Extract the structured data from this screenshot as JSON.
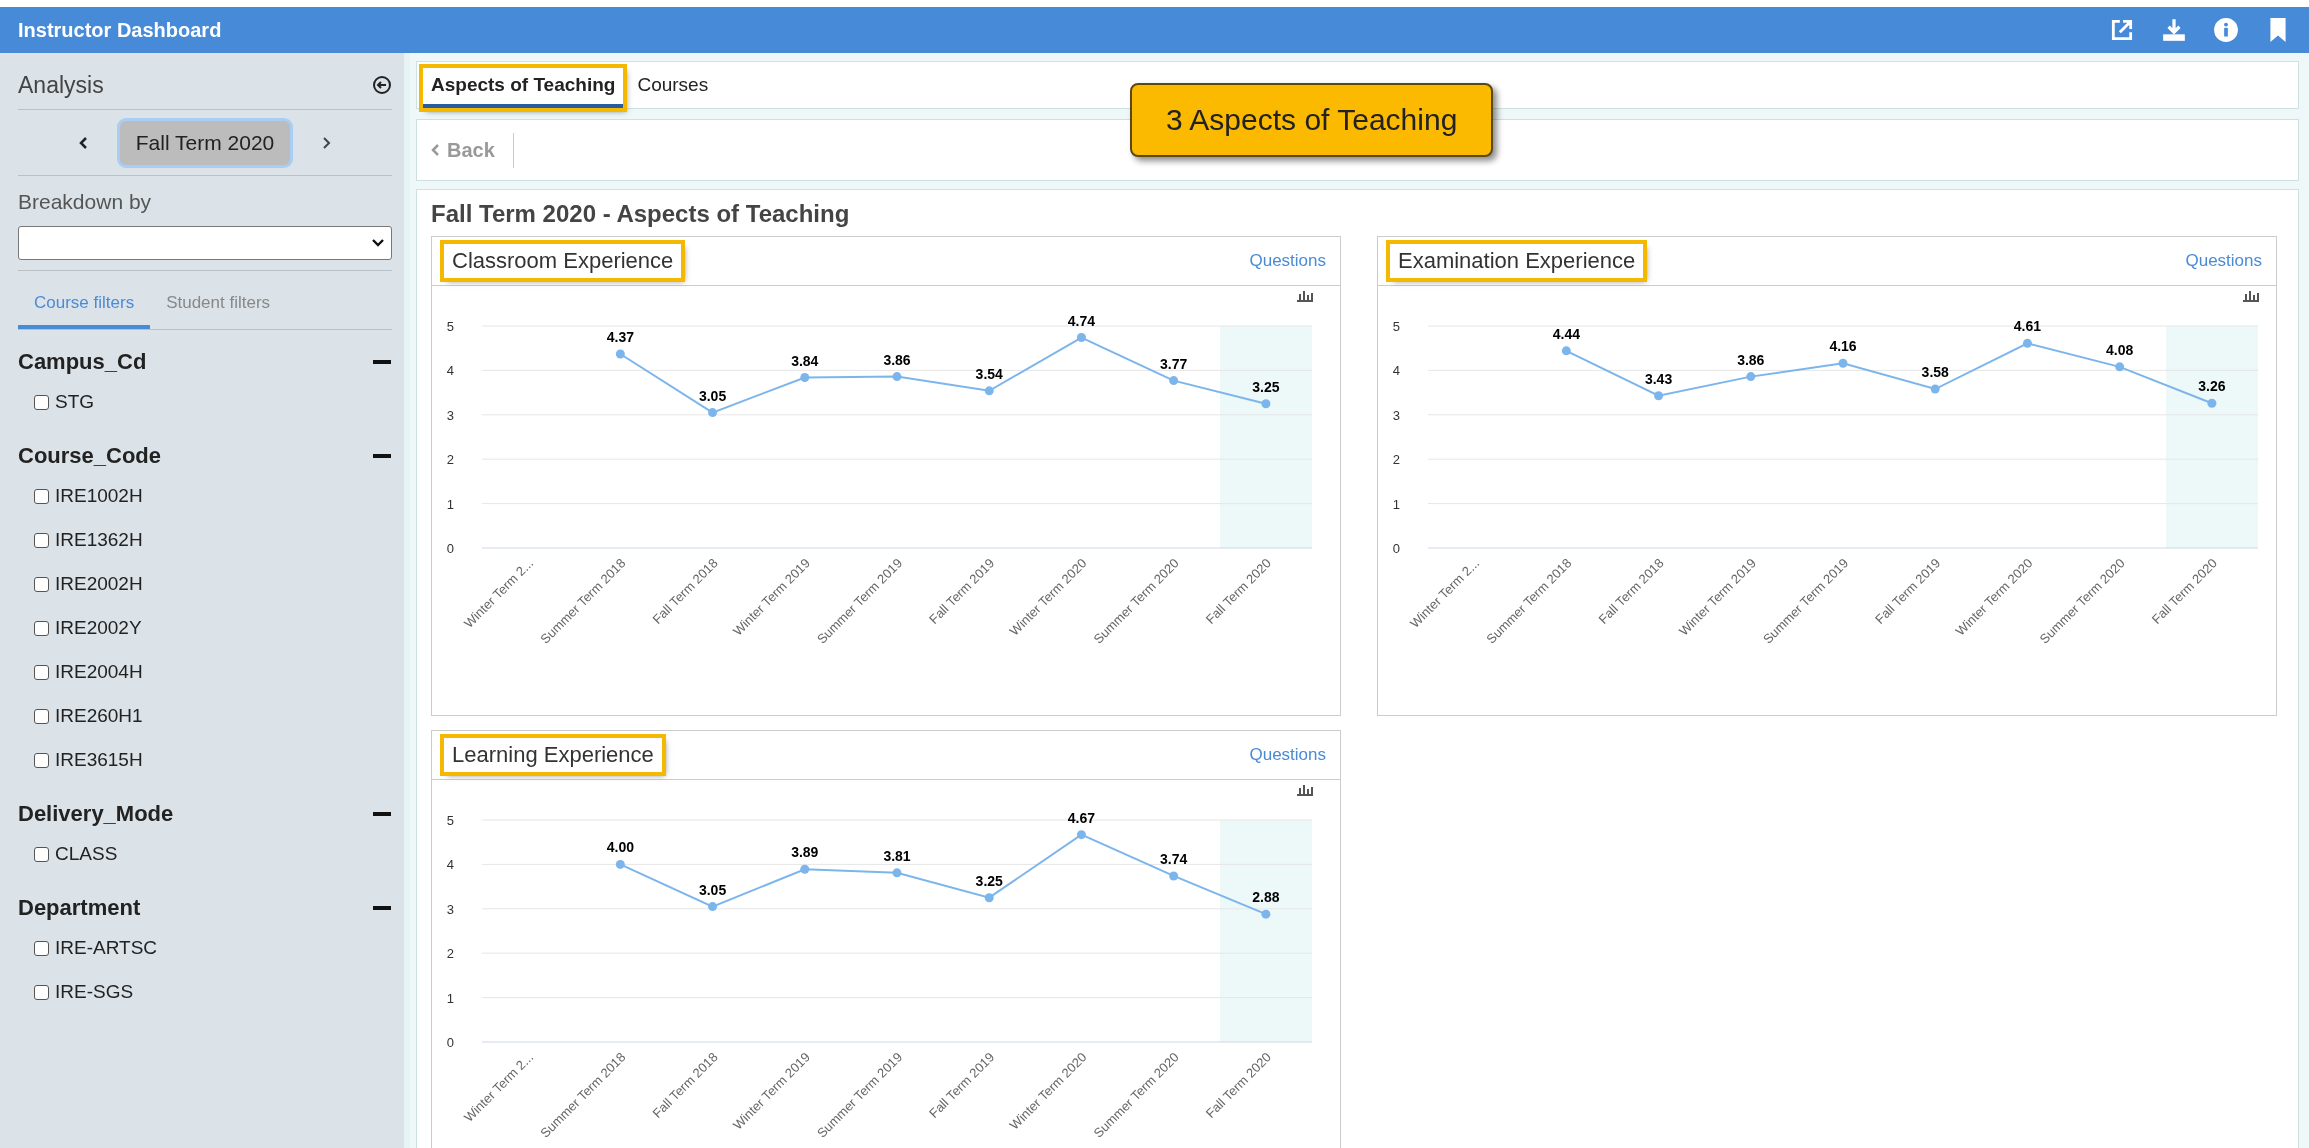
{
  "header": {
    "title": "Instructor Dashboard"
  },
  "sidebar": {
    "title": "Analysis",
    "term": {
      "label": "Fall Term 2020"
    },
    "breakdown": {
      "label": "Breakdown by"
    },
    "filter_tabs": [
      {
        "label": "Course filters",
        "selected": true
      },
      {
        "label": "Student filters",
        "selected": false
      }
    ],
    "groups": [
      {
        "title": "Campus_Cd",
        "expanded": true,
        "options": [
          {
            "label": "STG",
            "checked": false
          }
        ]
      },
      {
        "title": "Course_Code",
        "expanded": true,
        "options": [
          {
            "label": "IRE1002H",
            "checked": false
          },
          {
            "label": "IRE1362H",
            "checked": false
          },
          {
            "label": "IRE2002H",
            "checked": false
          },
          {
            "label": "IRE2002Y",
            "checked": false
          },
          {
            "label": "IRE2004H",
            "checked": false
          },
          {
            "label": "IRE260H1",
            "checked": false
          },
          {
            "label": "IRE3615H",
            "checked": false
          }
        ]
      },
      {
        "title": "Delivery_Mode",
        "expanded": true,
        "options": [
          {
            "label": "CLASS",
            "checked": false
          }
        ]
      },
      {
        "title": "Department",
        "expanded": true,
        "options": [
          {
            "label": "IRE-ARTSC",
            "checked": false
          },
          {
            "label": "IRE-SGS",
            "checked": false
          }
        ]
      }
    ]
  },
  "tabs": [
    {
      "label": "Aspects of Teaching",
      "selected": true,
      "highlighted": true
    },
    {
      "label": "Courses",
      "selected": false,
      "highlighted": false
    }
  ],
  "callout": {
    "text": "3 Aspects of Teaching"
  },
  "back_button": {
    "label": "Back"
  },
  "page_title": "Fall Term 2020 - Aspects of Teaching",
  "cards": [
    {
      "title": "Classroom Experience",
      "highlighted": true,
      "link": "Questions",
      "current_term_shaded": true,
      "chart_data": {
        "type": "line",
        "categories": [
          "Winter Term 2...",
          "Summer Term 2018",
          "Fall Term 2018",
          "Winter Term 2019",
          "Summer Term 2019",
          "Fall Term 2019",
          "Winter Term 2020",
          "Summer Term 2020",
          "Fall Term 2020"
        ],
        "ylim": [
          0,
          5
        ],
        "yticks": [
          0,
          1,
          2,
          3,
          4,
          5
        ],
        "grid": true,
        "value_labels": [
          null,
          "4.37",
          "3.05",
          "3.84",
          "3.86",
          "3.54",
          "4.74",
          "3.77",
          "3.25"
        ],
        "series": [
          {
            "color": "#7cb5ec",
            "marker": true,
            "values": [
              null,
              4.37,
              3.05,
              3.84,
              3.86,
              3.54,
              4.74,
              3.77,
              3.25
            ]
          }
        ]
      }
    },
    {
      "title": "Examination Experience",
      "highlighted": true,
      "link": "Questions",
      "current_term_shaded": true,
      "chart_data": {
        "type": "line",
        "categories": [
          "Winter Term 2...",
          "Summer Term 2018",
          "Fall Term 2018",
          "Winter Term 2019",
          "Summer Term 2019",
          "Fall Term 2019",
          "Winter Term 2020",
          "Summer Term 2020",
          "Fall Term 2020"
        ],
        "ylim": [
          0,
          5
        ],
        "yticks": [
          0,
          1,
          2,
          3,
          4,
          5
        ],
        "grid": true,
        "value_labels": [
          null,
          "4.44",
          "3.43",
          "3.86",
          "4.16",
          "3.58",
          "4.61",
          "4.08",
          "3.26"
        ],
        "series": [
          {
            "color": "#7cb5ec",
            "marker": true,
            "values": [
              null,
              4.44,
              3.43,
              3.86,
              4.16,
              3.58,
              4.61,
              4.08,
              3.26
            ]
          }
        ]
      }
    },
    {
      "title": "Learning Experience",
      "highlighted": true,
      "link": "Questions",
      "current_term_shaded": true,
      "chart_data": {
        "type": "line",
        "categories": [
          "Winter Term 2...",
          "Summer Term 2018",
          "Fall Term 2018",
          "Winter Term 2019",
          "Summer Term 2019",
          "Fall Term 2019",
          "Winter Term 2020",
          "Summer Term 2020",
          "Fall Term 2020"
        ],
        "ylim": [
          0,
          5
        ],
        "yticks": [
          0,
          1,
          2,
          3,
          4,
          5
        ],
        "grid": true,
        "value_labels": [
          null,
          "4.00",
          "3.05",
          "3.89",
          "3.81",
          "3.25",
          "4.67",
          "3.74",
          "2.88"
        ],
        "series": [
          {
            "color": "#7cb5ec",
            "marker": true,
            "values": [
              null,
              4.0,
              3.05,
              3.89,
              3.81,
              3.25,
              4.67,
              3.74,
              2.88
            ]
          }
        ]
      }
    }
  ]
}
